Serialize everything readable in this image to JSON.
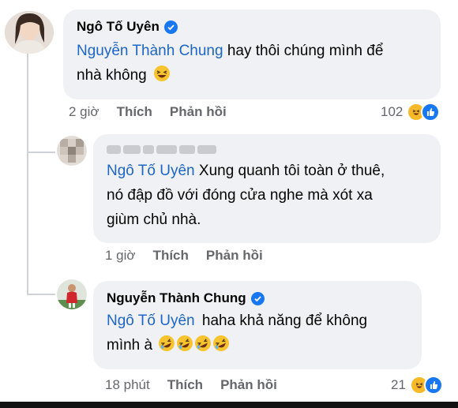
{
  "comments": [
    {
      "author": "Ngô Tố Uyên",
      "verified": true,
      "mention": "Nguyễn Thành Chung",
      "text": "hay thôi chúng mình để nhà không",
      "line2": "nhà không",
      "line1_rest": "hay thôi chúng mình để",
      "emoji": "grinning-squinting-face",
      "time": "2 giờ",
      "like_label": "Thích",
      "reply_label": "Phản hồi",
      "reaction_count": "102"
    },
    {
      "author_blurred": true,
      "mention": "Ngô Tố Uyên",
      "line1_rest": "Xung quanh tôi toàn ở thuê,",
      "line2": "nó đập đồ với đóng cửa nghe mà xót xa",
      "line3": "giùm chủ nhà.",
      "time": "1 giờ",
      "like_label": "Thích",
      "reply_label": "Phản hồi"
    },
    {
      "author": "Nguyễn Thành Chung",
      "verified": true,
      "mention": "Ngô Tố Uyên",
      "line1_rest": "haha khả năng để không",
      "line2": "mình à",
      "emoji": "rolling-on-floor-laughing",
      "emoji_count": 4,
      "time": "18 phút",
      "like_label": "Thích",
      "reply_label": "Phản hồi",
      "reaction_count": "21"
    }
  ],
  "colors": {
    "bubble": "#eff1f4",
    "mention": "#1d65c7",
    "meta": "#65676b",
    "verified": "#1877f2",
    "haha": "#f7b928"
  }
}
